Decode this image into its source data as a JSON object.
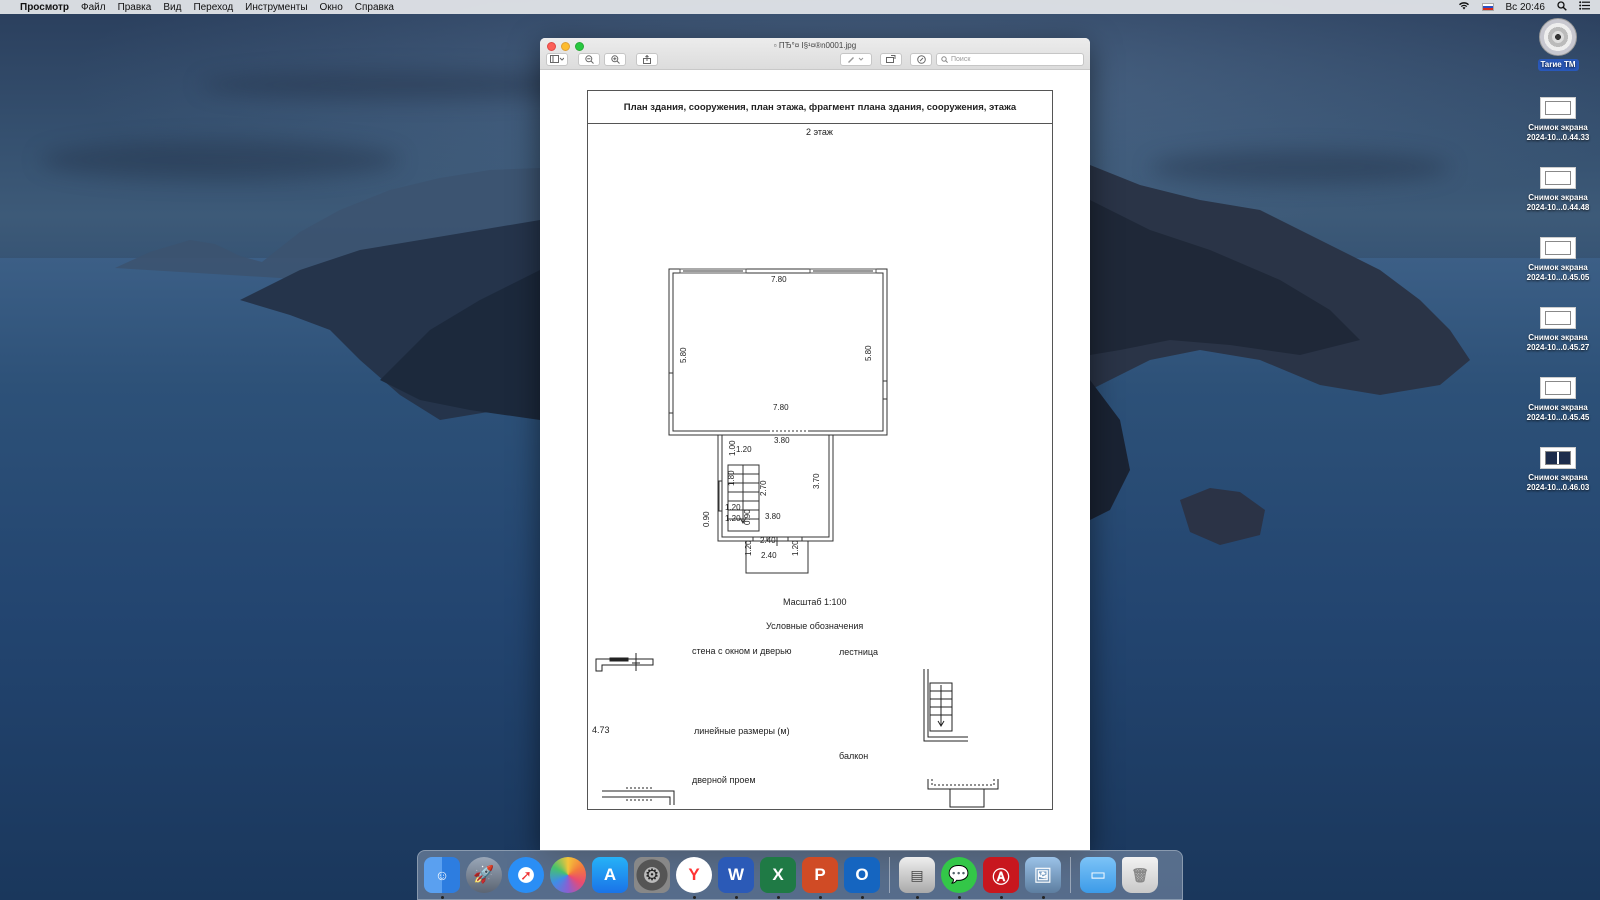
{
  "menubar": {
    "app_name": "Просмотр",
    "items": [
      "Файл",
      "Правка",
      "Вид",
      "Переход",
      "Инструменты",
      "Окно",
      "Справка"
    ],
    "clock": "Вс 20:46"
  },
  "desktop": {
    "disk_label": "Tarие TM",
    "screenshots": [
      {
        "line1": "Снимок экрана",
        "line2": "2024-10...0.44.33"
      },
      {
        "line1": "Снимок экрана",
        "line2": "2024-10...0.44.48"
      },
      {
        "line1": "Снимок экрана",
        "line2": "2024-10...0.45.05"
      },
      {
        "line1": "Снимок экрана",
        "line2": "2024-10...0.45.27"
      },
      {
        "line1": "Снимок экрана",
        "line2": "2024-10...0.45.45"
      },
      {
        "line1": "Снимок экрана",
        "line2": "2024-10...0.46.03"
      }
    ]
  },
  "window": {
    "title": "ПЂ°¤ I§¹¤®n0001.jpg",
    "search_placeholder": "Поиск"
  },
  "document": {
    "title": "План здания, сооружения, план этажа, фрагмент плана здания, сооружения, этажа",
    "floor": "2  этаж",
    "scale": "Масштаб 1:100",
    "legend_title": "Условные обозначения",
    "legend_wall": "стена с окном и дверью",
    "legend_stairs": "лестница",
    "legend_sample_dim": "4.73",
    "legend_dims": "линейные  размеры (м)",
    "legend_balcony": "балкон",
    "legend_door": "дверной  проем",
    "dims": {
      "top": "7.80",
      "left": "5.80",
      "right": "5.80",
      "mid": "7.80",
      "corridor_top": "3.80",
      "d100": "1.00",
      "d120a": "1.20",
      "d180": "1.80",
      "d270": "2.70",
      "d370": "3.70",
      "d090a": "0.90",
      "d090b": "0.90",
      "d120b": "1.20",
      "d120c": "1.20",
      "bottom": "3.80",
      "balcony_top": "2.40",
      "balcony_bottom": "2.40",
      "bal_left": "1.20",
      "bal_right": "1.20"
    }
  },
  "dock": {
    "apps": [
      "finder",
      "launchpad",
      "safari",
      "photos",
      "app-store",
      "system-preferences",
      "yandex-browser",
      "word",
      "excel",
      "powerpoint",
      "outlook",
      "printer",
      "messages",
      "acrobat",
      "preview",
      "downloads-folder",
      "trash"
    ]
  }
}
